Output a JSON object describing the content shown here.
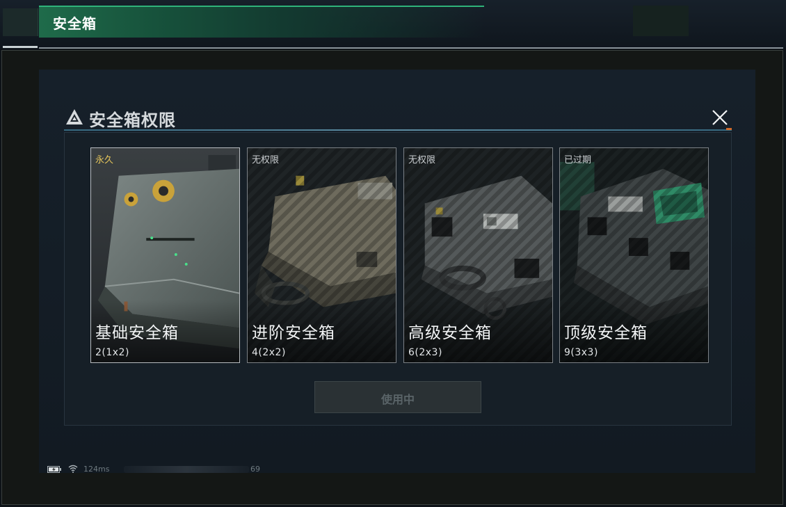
{
  "window": {
    "title": "安全箱"
  },
  "dialog": {
    "title": "安全箱权限",
    "close_icon": "close-icon",
    "warning_icon": "warning-triangle-icon"
  },
  "cards": [
    {
      "status": "永久",
      "name": "基础安全箱",
      "capacity": "2(1x2)",
      "selected": true
    },
    {
      "status": "无权限",
      "name": "进阶安全箱",
      "capacity": "4(2x2)",
      "selected": false
    },
    {
      "status": "无权限",
      "name": "高级安全箱",
      "capacity": "6(2x3)",
      "selected": false
    },
    {
      "status": "已过期",
      "name": "顶级安全箱",
      "capacity": "9(3x3)",
      "selected": false
    }
  ],
  "use_button": {
    "label": "使用中",
    "enabled": false
  },
  "statusbar": {
    "ping": "124ms",
    "fps": "69"
  },
  "colors": {
    "accent_green": "#2fb37a",
    "permanent_gold": "#e3c35a",
    "teal_interior": "#2f8a66"
  }
}
